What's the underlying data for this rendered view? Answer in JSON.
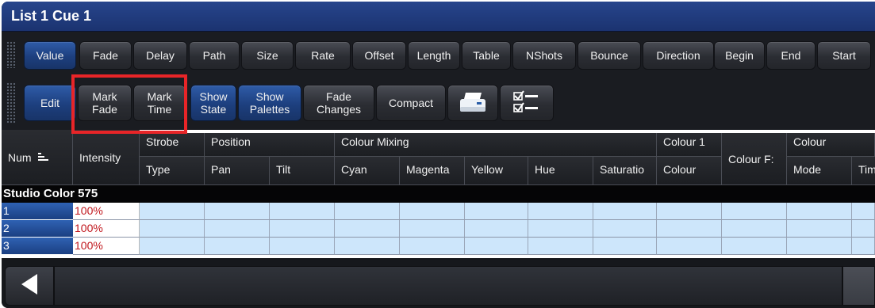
{
  "window": {
    "title": "List 1 Cue 1"
  },
  "toolbar_top": {
    "tabs": [
      {
        "label": "Value",
        "active": true
      },
      {
        "label": "Fade"
      },
      {
        "label": "Delay"
      },
      {
        "label": "Path"
      },
      {
        "label": "Size"
      },
      {
        "label": "Rate"
      },
      {
        "label": "Offset"
      },
      {
        "label": "Length"
      },
      {
        "label": "Table"
      },
      {
        "label": "NShots"
      },
      {
        "label": "Bounce"
      },
      {
        "label": "Direction"
      },
      {
        "label": "Begin"
      },
      {
        "label": "End"
      },
      {
        "label": "Start"
      }
    ]
  },
  "toolbar_bottom": {
    "edit": "Edit",
    "mark_fade": [
      "Mark",
      "Fade"
    ],
    "mark_time": [
      "Mark",
      "Time"
    ],
    "show_state": [
      "Show",
      "State"
    ],
    "show_palettes": [
      "Show",
      "Palettes"
    ],
    "fade_changes": [
      "Fade",
      "Changes"
    ],
    "compact": "Compact",
    "print_icon": "printer-icon",
    "checklist_icon": "checklist-icon"
  },
  "grid": {
    "headers": {
      "num": "Num",
      "intensity": "Intensity",
      "strobe": "Strobe",
      "strobe_sub": "Type",
      "position": "Position",
      "pan": "Pan",
      "tilt": "Tilt",
      "colour_mixing": "Colour Mixing",
      "cyan": "Cyan",
      "magenta": "Magenta",
      "yellow": "Yellow",
      "hue": "Hue",
      "saturation": "Saturatio",
      "colour1": "Colour 1",
      "colour1_sub": "Colour",
      "colour_f": "Colour F:",
      "colour": "Colour",
      "colour_sub": "Mode",
      "tim": "Tim"
    },
    "group": "Studio Color 575",
    "rows": [
      {
        "num": "1",
        "intensity": "100%"
      },
      {
        "num": "2",
        "intensity": "100%"
      },
      {
        "num": "3",
        "intensity": "100%"
      }
    ]
  },
  "colors": {
    "title_bar": "#1f3a7c",
    "active_button": "#2a539c",
    "value_cell": "#cde6fb",
    "intensity_text": "#c0151b",
    "highlight": "#e82528"
  }
}
